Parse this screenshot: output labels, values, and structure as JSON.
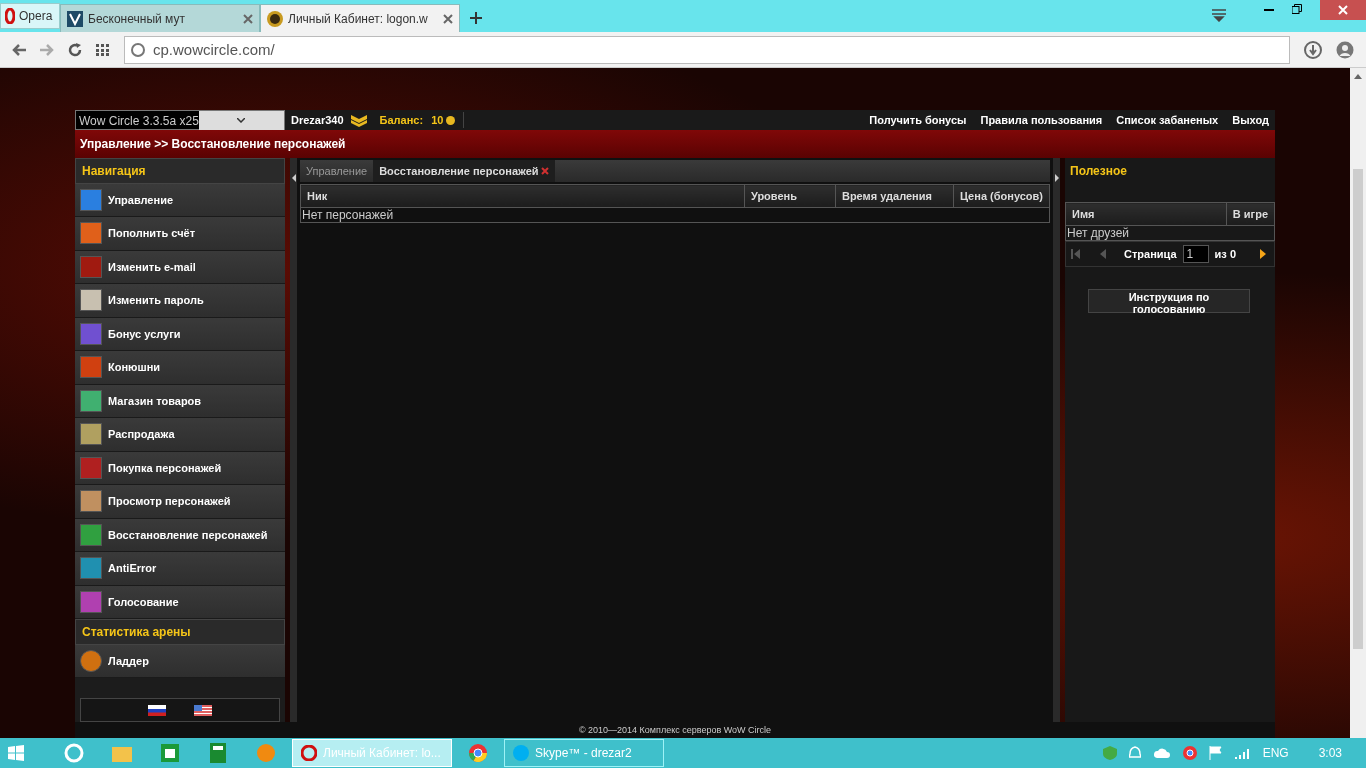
{
  "browser": {
    "menu_label": "Opera",
    "tabs": [
      {
        "label": "Бесконечный мут",
        "selected": false,
        "kind": "v"
      },
      {
        "label": "Личный Кабинет: logon.w",
        "selected": true,
        "kind": "wow"
      }
    ],
    "address": "cp.wowcircle.com/"
  },
  "site": {
    "server_select": "Wow Circle 3.3.5a x25",
    "user": "Drezar340",
    "balance_label": "Баланс:",
    "balance": "10",
    "top_links": [
      "Получить бонусы",
      "Правила пользования",
      "Список забаненых",
      "Выход"
    ],
    "breadcrumb": "Управление >> Восстановление персонажей",
    "nav_title": "Навигация",
    "nav_items": [
      {
        "label": "Управление",
        "color": "#2a7fe0"
      },
      {
        "label": "Пополнить счёт",
        "color": "#e0601a"
      },
      {
        "label": "Изменить e-mail",
        "color": "#a01a10"
      },
      {
        "label": "Изменить пароль",
        "color": "#c8c0b0"
      },
      {
        "label": "Бонус услуги",
        "color": "#7050d0"
      },
      {
        "label": "Конюшни",
        "color": "#d04010"
      },
      {
        "label": "Магазин товаров",
        "color": "#40b070"
      },
      {
        "label": "Распродажа",
        "color": "#b0a060"
      },
      {
        "label": "Покупка персонажей",
        "color": "#b02020"
      },
      {
        "label": "Просмотр персонажей",
        "color": "#c09060"
      },
      {
        "label": "Восстановление персонажей",
        "color": "#30a040"
      },
      {
        "label": "AntiError",
        "color": "#2090b0"
      },
      {
        "label": "Голосование",
        "color": "#b040b0"
      }
    ],
    "arena_title": "Статистика арены",
    "arena_items": [
      {
        "label": "Ладдер",
        "color": "#d07010"
      }
    ],
    "tabs": [
      {
        "label": "Управление",
        "selected": false,
        "closable": false
      },
      {
        "label": "Восстановление персонажей",
        "selected": true,
        "closable": true
      }
    ],
    "table": {
      "columns": [
        "Ник",
        "Уровень",
        "Время удаления",
        "Цена (бонусов)"
      ],
      "empty": "Нет персонажей"
    },
    "useful": {
      "title": "Полезное",
      "columns": [
        "Имя",
        "В игре"
      ],
      "empty": "Нет друзей",
      "pager": {
        "label": "Страница",
        "page": "1",
        "of": "из 0"
      },
      "button": "Инструкция по голосованию"
    },
    "footer": "© 2010—2014 Комплекс серверов WoW Circle"
  },
  "taskbar": {
    "apps": [
      {
        "kind": "ie"
      },
      {
        "kind": "folder"
      },
      {
        "kind": "store"
      },
      {
        "kind": "calc"
      },
      {
        "kind": "orange"
      },
      {
        "kind": "opera",
        "label": "Личный Кабинет: lo...",
        "selected": true
      },
      {
        "kind": "chrome"
      },
      {
        "kind": "skype",
        "label": "Skype™ - drezar2",
        "selected": false
      }
    ],
    "language": "ENG",
    "time": "3:03"
  }
}
